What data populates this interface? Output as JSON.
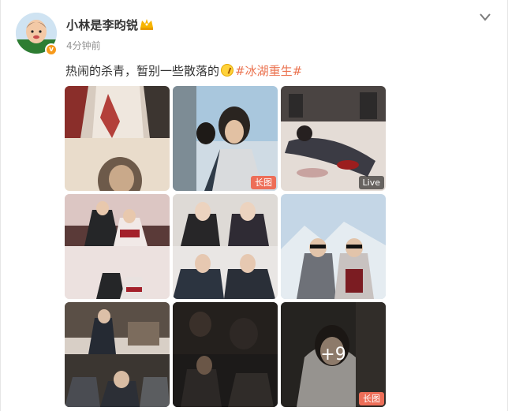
{
  "post": {
    "username": "小林是李昀锐",
    "timestamp": "4分钟前",
    "text_before": "热闹的杀青，暂别一些散落的",
    "emoji_icon": "sparkle-emoji",
    "hashtag": "#冰湖重生#"
  },
  "grid": {
    "badges": {
      "tile2": "长图",
      "tile3": "Live",
      "tile9": "长图"
    },
    "more_count": "+9"
  },
  "colors": {
    "hashtag": "#eb7350",
    "long_badge": "#ed6e58",
    "vip": "#f79a1b"
  }
}
